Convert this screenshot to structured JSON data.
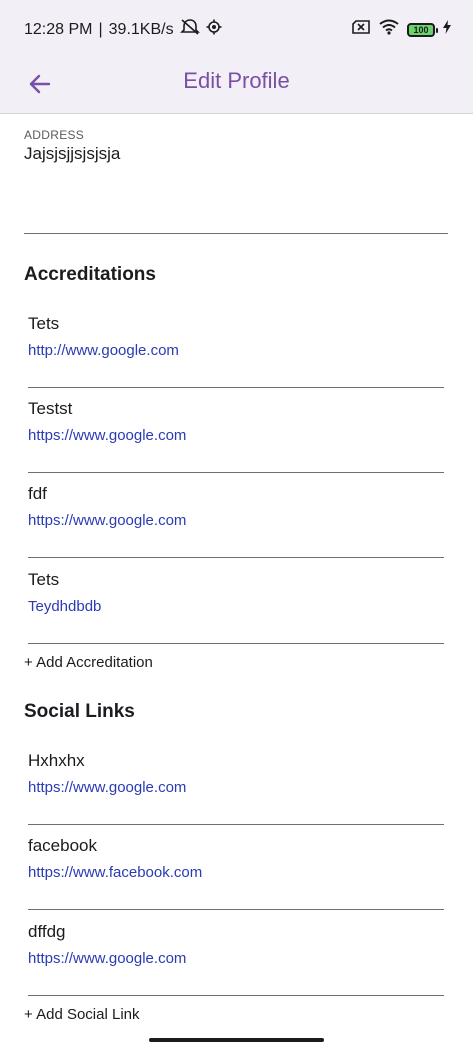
{
  "status_bar": {
    "time": "12:28 PM",
    "separator": "|",
    "network_speed": "39.1KB/s",
    "battery_level": "100",
    "icons": [
      "alarm-off-icon",
      "settings-icon",
      "sim-off-icon",
      "wifi-icon",
      "battery-icon",
      "charging-icon"
    ]
  },
  "app_bar": {
    "title": "Edit Profile",
    "back_icon": "arrow-left-icon"
  },
  "address": {
    "label": "ADDRESS",
    "value": "Jajsjsjjsjsjsja"
  },
  "accreditations": {
    "title": "Accreditations",
    "items": [
      {
        "name": "Tets",
        "link": "http://www.google.com"
      },
      {
        "name": "Testst",
        "link": "https://www.google.com"
      },
      {
        "name": "fdf",
        "link": "https://www.google.com"
      },
      {
        "name": "Tets",
        "link": "Teydhdbdb"
      }
    ],
    "add_label": "+ Add Accreditation"
  },
  "social_links": {
    "title": "Social Links",
    "items": [
      {
        "name": "Hxhxhx",
        "link": "https://www.google.com"
      },
      {
        "name": "facebook",
        "link": "https://www.facebook.com"
      },
      {
        "name": "dffdg",
        "link": "https://www.google.com"
      }
    ],
    "add_label": "+ Add Social Link"
  },
  "colors": {
    "accent": "#7a50a4",
    "link": "#2a3bb3",
    "background": "#f3eff7"
  }
}
